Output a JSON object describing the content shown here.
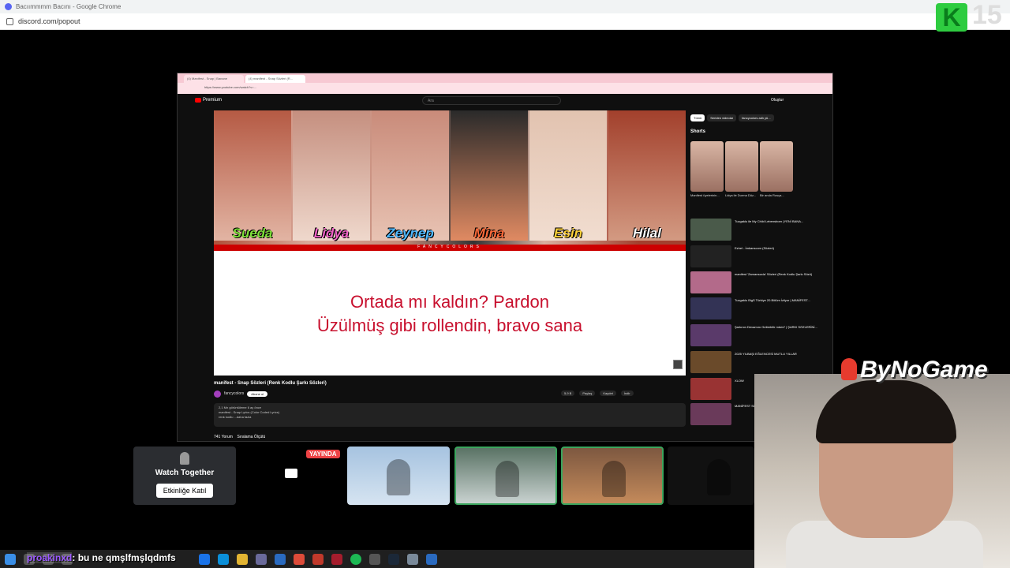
{
  "browser": {
    "tab_title": "Bacıımmmm Bacını - Google Chrome",
    "url": "discord.com/popout"
  },
  "overlay": {
    "counter": "15"
  },
  "inner_browser": {
    "tabs": [
      "(4) Manifest - Snap | Banane",
      "(4) manifest - Snap Sözleri (R..."
    ],
    "url": "https://www.youtube.com/watch?v=..."
  },
  "youtube": {
    "logo_label": "Premium",
    "search_placeholder": "Ara",
    "create_label": "Oluştur",
    "members": [
      "Sueda",
      "Lidya",
      "Zeynep",
      "Mina",
      "Esin",
      "Hilal"
    ],
    "member_colors": [
      "#7ee03a",
      "#f062c6",
      "#4fb8ff",
      "#ff6a3a",
      "#ffd23a",
      "#ffffff"
    ],
    "brand": "FANCYCOLORS",
    "lyric_line1": "Ortada mı kaldın? Pardon",
    "lyric_line2": "Üzülmüş gibi rollendin, bravo sana",
    "video_title": "manifest - Snap Sözleri (Renk Kodlu Şarkı Sözleri)",
    "channel": "fancycolors",
    "subscribe": "Abone ol",
    "actions": [
      "5,9 B",
      "Paylaş",
      "Kaydet",
      "İndir"
    ],
    "desc_line1": "2,1 Mn görüntüleme  6 ay önce",
    "desc_line2": "manifest - Snap Lyrics (Color Coded Lyrics)",
    "desc_line3": "renk kodlu ...daha fazla",
    "comments": "741 Yorum",
    "sort": "Sıralama Ölçütü",
    "chips": [
      "Tümü",
      "Seriden videolar",
      "fancycolors adlı yü..."
    ],
    "shorts_title": "Shorts",
    "shorts": [
      "Manifest üyelerinin...",
      "Lidya ile Durma Düz...",
      "Bir anda Rusça..."
    ],
    "related": [
      "Tuzgaklu ile My Child Lebensborn (YENİ BANA...",
      "Ezhel - İmkansızım (Sözleri)",
      "manifest 'Zamansızda' Sözleri (Renk Kodlu Şarkı Sözü)",
      "Tuzgaklu BigS Türkiye 20.Bölüm İzliyor | MANİFEST...",
      "Şarkının Devamını Getirebilir misin? | ŞARKI SÖZLERİNİ...",
      "2025 YILBAŞI EĞLENCESİ MUTLU YILLAR",
      "XLOW",
      "MANİFEST Sözleri"
    ]
  },
  "discord": {
    "watch_title": "Watch Together",
    "watch_button": "Etkinliğe Katıl",
    "live_badge": "YAYINDA"
  },
  "stream": {
    "brand": "ByNoGame",
    "chat_user": "proakinxd",
    "chat_message": ": bu ne qmşlfmşlqdmfs"
  }
}
